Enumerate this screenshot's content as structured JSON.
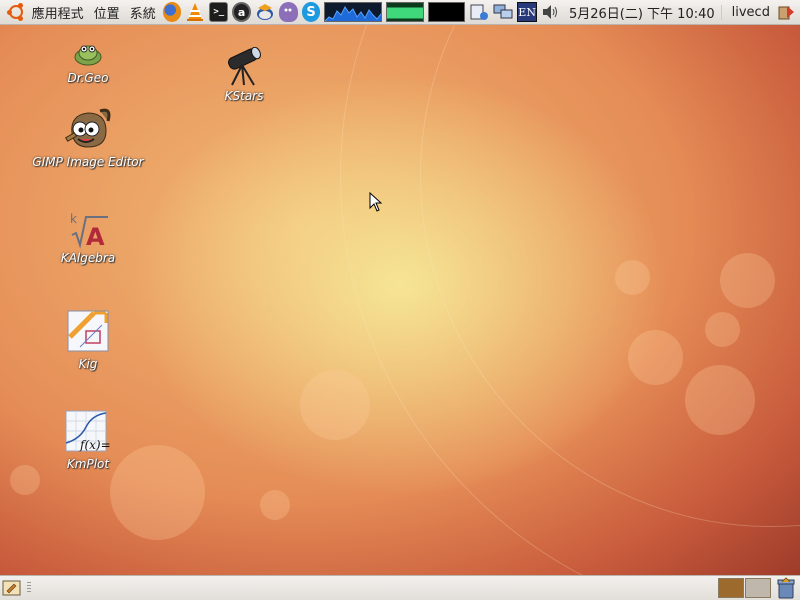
{
  "top_panel": {
    "menus": [
      "應用程式",
      "位置",
      "系統"
    ],
    "launchers": [
      "firefox-icon",
      "vlc-icon",
      "terminal-icon",
      "audacious-icon",
      "thunderbird-icon",
      "pidgin-icon",
      "skype-icon"
    ],
    "tray_en": "EN",
    "clock": "5月26日(二) 下午 10:40",
    "user": "livecd"
  },
  "desktop": {
    "icons": [
      {
        "label": "Dr.Geo",
        "icon": "drgeo-icon"
      },
      {
        "label": "KStars",
        "icon": "kstars-icon"
      },
      {
        "label": "GIMP Image Editor",
        "icon": "gimp-icon"
      },
      {
        "label": "KAlgebra",
        "icon": "kalgebra-icon"
      },
      {
        "label": "Kig",
        "icon": "kig-icon"
      },
      {
        "label": "KmPlot",
        "icon": "kmplot-icon"
      }
    ]
  },
  "bottom_panel": {
    "workspaces": 2,
    "active_workspace": 1
  },
  "colors": {
    "ubuntu_orange": "#e55b0a",
    "workspace_active": "#9b6a2c",
    "workspace_inactive": "#bfb7ac"
  }
}
